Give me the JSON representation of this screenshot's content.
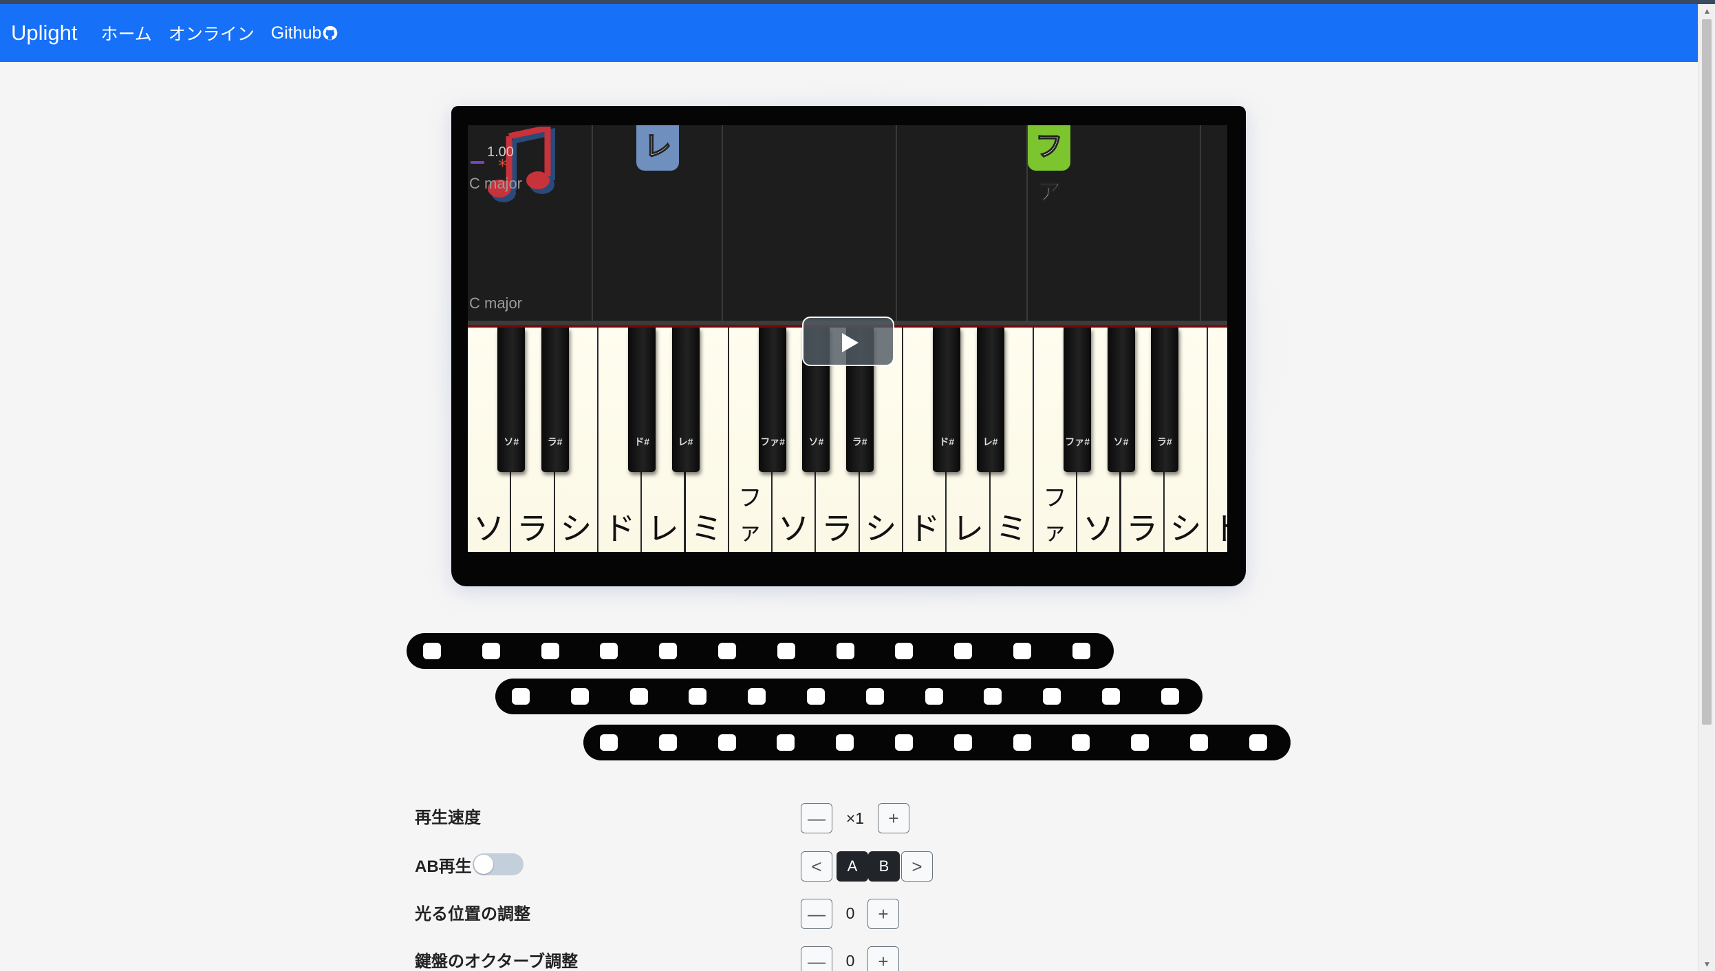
{
  "nav": {
    "brand": "Uplight",
    "links": [
      "ホーム",
      "オンライン",
      "Github"
    ]
  },
  "player": {
    "speed_display": "1.00",
    "key_label_top": "C major",
    "key_label_bottom": "C major",
    "falling_notes": [
      "レ",
      "ファ"
    ],
    "white_keys": [
      "ソ",
      "ラ",
      "シ",
      "ド",
      "レ",
      "ミ",
      "ファ",
      "ソ",
      "ラ",
      "シ",
      "ド",
      "レ",
      "ミ",
      "ファ",
      "ソ",
      "ラ",
      "シ",
      "ド"
    ],
    "black_keys": [
      "ソ#",
      "ラ#",
      "ド#",
      "レ#",
      "ファ#",
      "ソ#",
      "ラ#",
      "ド#",
      "レ#",
      "ファ#",
      "ソ#",
      "ラ#"
    ]
  },
  "controls": {
    "speed_label": "再生速度",
    "speed_value": "×1",
    "minus": "—",
    "plus": "+",
    "ab_label": "AB再生",
    "prev": "<",
    "a": "A",
    "b": "B",
    "next": ">",
    "light_label": "光る位置の調整",
    "light_value": "0",
    "octave_label": "鍵盤のオクターブ調整",
    "octave_value": "0"
  },
  "colors": {
    "navbar": "#1670f8",
    "note_re": "#6f8fbf",
    "note_fa": "#7cc52f"
  }
}
